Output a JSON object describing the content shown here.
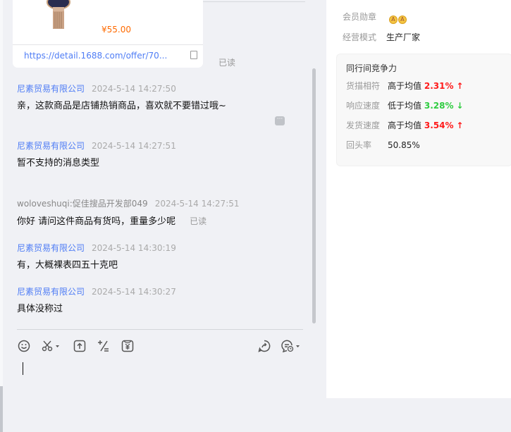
{
  "product_card": {
    "price": "¥55.00",
    "link": "https://detail.1688.com/offer/70...",
    "read_status": "已读"
  },
  "messages": [
    {
      "sender": "尼素贸易有限公司",
      "time": "2024-5-14 14:27:50",
      "text": "亲，这款商品是店铺热销商品，喜欢就不要错过哦~"
    },
    {
      "sender": "尼素贸易有限公司",
      "time": "2024-5-14 14:27:51",
      "text": "暂不支持的消息类型"
    },
    {
      "sender": "woloveshuqi:促佳搜品开发部049",
      "time": "2024-5-14 14:27:51",
      "text": "你好 请问这件商品有货吗，重量多少呢",
      "read_status": "已读"
    },
    {
      "sender": "尼素贸易有限公司",
      "time": "2024-5-14 14:30:19",
      "text": "有，大概裸表四五十克吧"
    },
    {
      "sender": "尼素贸易有限公司",
      "time": "2024-5-14 14:30:27",
      "text": "具体没称过"
    }
  ],
  "shop_info": {
    "badge_label": "会员勋章",
    "badge_glyph": "A",
    "mode_label": "经营模式",
    "mode_value": "生产厂家",
    "competition": {
      "title": "同行间竞争力",
      "rows": [
        {
          "label": "货描相符",
          "compare": "高于均值",
          "value": "2.31%",
          "arrow": "↑"
        },
        {
          "label": "响应速度",
          "compare": "低于均值",
          "value": "3.28%",
          "arrow": "↓"
        },
        {
          "label": "发货速度",
          "compare": "高于均值",
          "value": "3.54%",
          "arrow": "↑"
        }
      ],
      "repeat_label": "回头率",
      "repeat_value": "50.85%"
    }
  },
  "colors": {
    "link": "#4f7df5",
    "price": "#ff6a00",
    "up": "#ff1a1a",
    "down": "#2ecc40"
  }
}
